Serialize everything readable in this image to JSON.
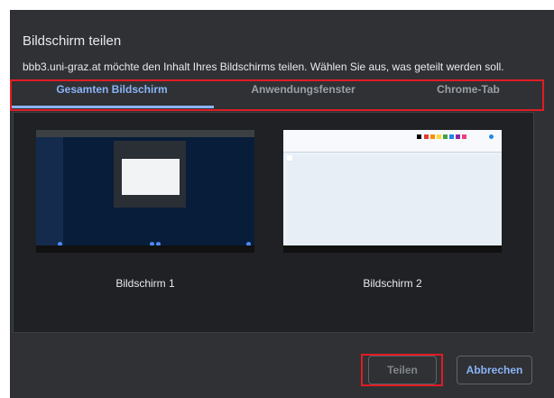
{
  "dialog": {
    "title": "Bildschirm teilen",
    "subtitle": "bbb3.uni-graz.at möchte den Inhalt Ihres Bildschirms teilen. Wählen Sie aus, was geteilt werden soll."
  },
  "tabs": [
    {
      "label": "Gesamten Bildschirm",
      "active": true
    },
    {
      "label": "Anwendungsfenster",
      "active": false
    },
    {
      "label": "Chrome-Tab",
      "active": false
    }
  ],
  "screens": [
    {
      "label": "Bildschirm 1"
    },
    {
      "label": "Bildschirm 2"
    }
  ],
  "buttons": {
    "share": "Teilen",
    "cancel": "Abbrechen"
  },
  "colors": {
    "dialog_bg": "#303134",
    "accent": "#8ab4f8",
    "highlight": "#e01c24"
  }
}
